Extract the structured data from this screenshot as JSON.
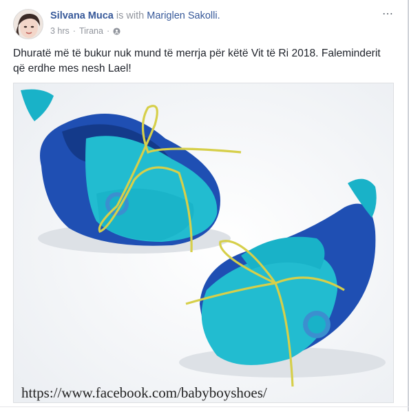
{
  "post": {
    "author": "Silvana Muca",
    "with_text": "is with",
    "tagged": "Mariglen Sakolli.",
    "time": "3 hrs",
    "separator": "·",
    "location": "Tirana",
    "body": "Dhuratë më të bukur nuk mund të merrja për këtë Vit të Ri 2018. Faleminderit që erdhe mes nesh Lael!",
    "watermark": "https://www.facebook.com/babyboyshoes/",
    "more_icon": "⋯"
  },
  "colors": {
    "link": "#365899",
    "meta": "#90949c",
    "text": "#1d2129",
    "turquoise": "#19b2c8",
    "royal_blue": "#1f4fb3",
    "lace": "#d6cf4a"
  }
}
